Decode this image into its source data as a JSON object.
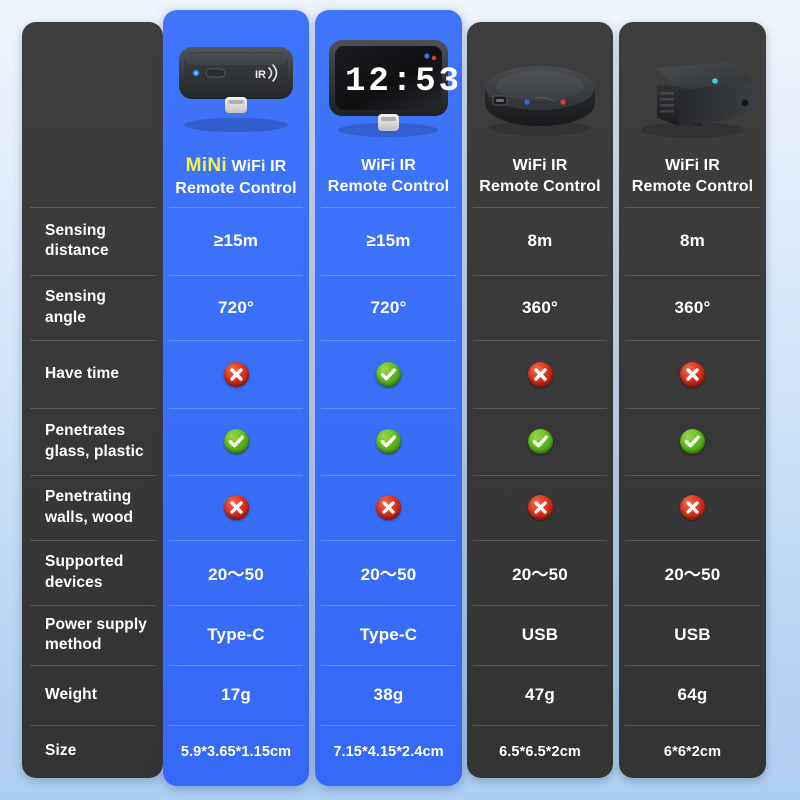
{
  "theme": {
    "accent_blue": "#3a6ff9",
    "panel_dark": "#3a3a3a",
    "highlight_yellow": "#f2f24a",
    "yes_green": "#64bd22",
    "no_red": "#dd3520",
    "text_white": "#ffffff",
    "background_top": "#eef4fb",
    "background_bottom": "#aecef0"
  },
  "columns": [
    {
      "id": "col-1",
      "highlighted": true,
      "name_prefix": "MiNi",
      "name_line1": "WiFi IR",
      "name_line2": "Remote Control",
      "device_icon": "usb-c-ir-dongle-icon",
      "device_label": "IR"
    },
    {
      "id": "col-2",
      "highlighted": true,
      "name_prefix": "",
      "name_line1": "WiFi IR",
      "name_line2": "Remote Control",
      "device_icon": "usb-c-clock-ir-dongle-icon",
      "device_label": "12:53"
    },
    {
      "id": "col-3",
      "highlighted": false,
      "name_prefix": "",
      "name_line1": "WiFi IR",
      "name_line2": "Remote Control",
      "device_icon": "round-ir-hub-icon",
      "device_label": ""
    },
    {
      "id": "col-4",
      "highlighted": false,
      "name_prefix": "",
      "name_line1": "WiFi IR",
      "name_line2": "Remote Control",
      "device_icon": "square-ir-hub-icon",
      "device_label": ""
    }
  ],
  "rows": [
    {
      "label_line1": "Sensing",
      "label_line2": "distance",
      "values": [
        "≥15m",
        "≥15m",
        "8m",
        "8m"
      ],
      "kind": "text"
    },
    {
      "label_line1": "Sensing",
      "label_line2": "angle",
      "values": [
        "720°",
        "720°",
        "360°",
        "360°"
      ],
      "kind": "text"
    },
    {
      "label_line1": "Have time",
      "label_line2": "",
      "values": [
        "no",
        "yes",
        "no",
        "no"
      ],
      "kind": "status"
    },
    {
      "label_line1": "Penetrates",
      "label_line2": "glass, plastic",
      "values": [
        "yes",
        "yes",
        "yes",
        "yes"
      ],
      "kind": "status"
    },
    {
      "label_line1": "Penetrating",
      "label_line2": "walls, wood",
      "values": [
        "no",
        "no",
        "no",
        "no"
      ],
      "kind": "status"
    },
    {
      "label_line1": "Supported",
      "label_line2": "devices",
      "values": [
        "20～50",
        "20～50",
        "20～50",
        "20～50"
      ],
      "kind": "text"
    },
    {
      "label_line1": "Power supply",
      "label_line2": "method",
      "values": [
        "Type-C",
        "Type-C",
        "USB",
        "USB"
      ],
      "kind": "text"
    },
    {
      "label_line1": "Weight",
      "label_line2": "",
      "values": [
        "17g",
        "38g",
        "47g",
        "64g"
      ],
      "kind": "text"
    },
    {
      "label_line1": "Size",
      "label_line2": "",
      "values": [
        "5.9*3.65*1.15cm",
        "7.15*4.15*2.4cm",
        "6.5*6.5*2cm",
        "6*6*2cm"
      ],
      "kind": "text-small"
    }
  ]
}
